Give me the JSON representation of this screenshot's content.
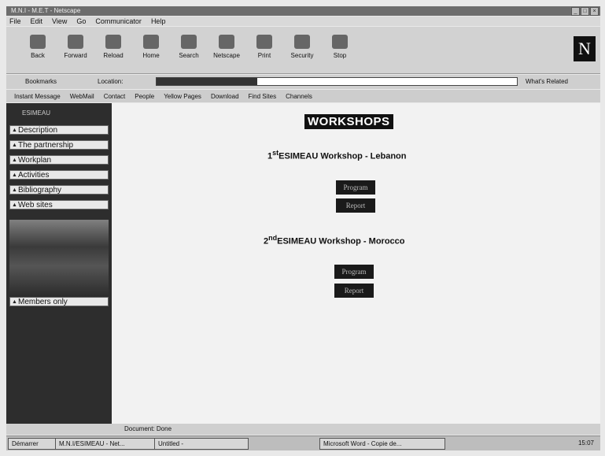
{
  "browser": {
    "title": "M.N.I - M.E.T - Netscape",
    "menu": [
      "File",
      "Edit",
      "View",
      "Go",
      "Communicator",
      "Help"
    ],
    "toolbar": [
      "Back",
      "Forward",
      "Reload",
      "Home",
      "Search",
      "Netscape",
      "Print",
      "Security",
      "Stop"
    ],
    "location_label": "Location:",
    "whats_related": "What's Related",
    "bookmarks_label": "Bookmarks",
    "personal_links": [
      "Instant Message",
      "WebMail",
      "Contact",
      "People",
      "Yellow Pages",
      "Download",
      "Find Sites",
      "Channels"
    ]
  },
  "sidebar": {
    "header": "ESIMEAU",
    "items": [
      "Description",
      "The partnership",
      "Workplan",
      "Activities",
      "Bibliography",
      "Web sites"
    ],
    "members_label": "Members only"
  },
  "main": {
    "title": "WORKSHOPS",
    "workshops": [
      {
        "num": "1",
        "sup": "st",
        "label": "ESIMEAU Workshop - Lebanon",
        "program": "Program",
        "report": "Report"
      },
      {
        "num": "2",
        "sup": "nd",
        "label": "ESIMEAU Workshop - Morocco",
        "program": "Program",
        "report": "Report"
      }
    ]
  },
  "status": {
    "text": "Document: Done"
  },
  "taskbar": {
    "start": "Démarrer",
    "tasks": [
      "M.N.I/ESIMEAU - Net...",
      "Untitled -",
      "Microsoft Word - Copie de..."
    ],
    "clock": "15:07"
  }
}
